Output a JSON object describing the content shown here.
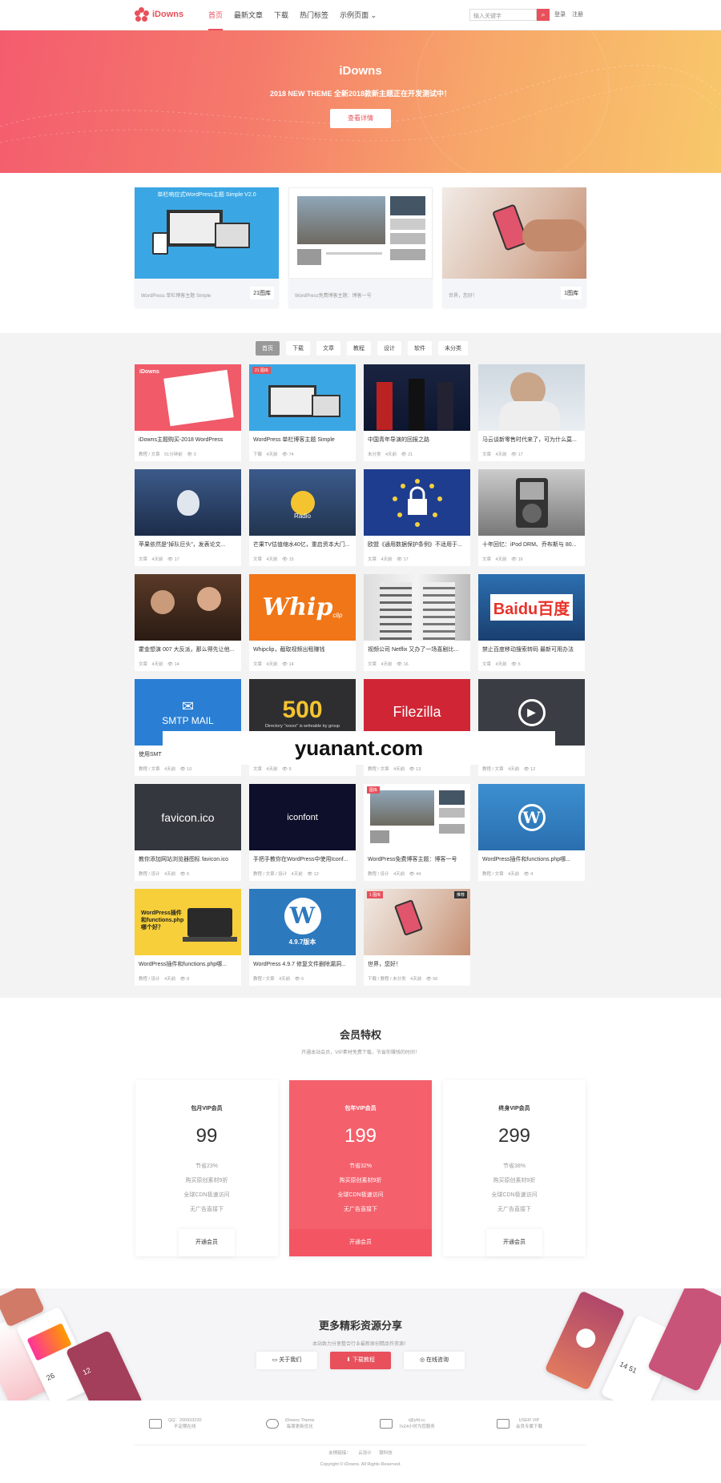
{
  "header": {
    "logo": "iDowns",
    "nav": [
      "首页",
      "最新文章",
      "下载",
      "热门标签",
      "示例页面"
    ],
    "search_placeholder": "输入关键字",
    "login": "登录",
    "register": "注册"
  },
  "hero": {
    "title": "iDowns",
    "subtitle": "2018 NEW THEME 全新2018款新主题正在开发测试中！",
    "button": "查看详情"
  },
  "featured": [
    {
      "caption": "WordPress 单栏博客主题 Simple",
      "count": "21图库"
    },
    {
      "caption": "WordPress免费博客主题：博客一号",
      "count": ""
    },
    {
      "caption": "世界，您好！",
      "count": "1图库"
    }
  ],
  "tabs": [
    "首页",
    "下载",
    "文章",
    "教程",
    "设计",
    "软件",
    "未分类"
  ],
  "cards": [
    {
      "title": "iDowns主题购买-2018 WordPress",
      "meta": "教程 / 文章　51分钟前　👁 3"
    },
    {
      "title": "WordPress 单栏博客主题 Simple",
      "meta": "下载　4天前　👁 74"
    },
    {
      "title": "中国青年导演的回报之路",
      "meta": "未分类　4天前　👁 21"
    },
    {
      "title": "马云谈新零售时代来了，可为什么莫...",
      "meta": "文章　4天前　👁 17"
    },
    {
      "title": "苹果依然是“掉队巨头”，发表论文...",
      "meta": "文章　4天前　👁 17"
    },
    {
      "title": "芒果TV估值缩水40亿，重启资本大门...",
      "meta": "文章　4天前　👁 15"
    },
    {
      "title": "欧盟《通用数据保护条例》不适用于...",
      "meta": "文章　4天前　👁 17"
    },
    {
      "title": "十年回忆：iPod DRM、乔布斯与 80...",
      "meta": "文章　4天前　👁 16"
    },
    {
      "title": "霍金想演 007 大反派，那么得先让他...",
      "meta": "文章　4天前　👁 14"
    },
    {
      "title": "Whipclip，截取视频出租赚钱",
      "meta": "文章　4天前　👁 14"
    },
    {
      "title": "视频公司 Netflix 又办了一场喜剧比...",
      "meta": "文章　4天前　👁 16"
    },
    {
      "title": "禁止百度移动搜索转码 最新可用办法",
      "meta": "文章　4天前　👁 5"
    },
    {
      "title": "使用SMT",
      "meta": "教程 / 文章　4天前　👁 10"
    },
    {
      "title": "",
      "meta": "文章　4天前　👁 5"
    },
    {
      "title": "",
      "meta": "教程 / 文章　4天前　👁 13"
    },
    {
      "title": "...链视频...",
      "meta": "教程 / 文章　4天前　👁 12"
    },
    {
      "title": "教你添加网站浏览器图标 favicon.ico",
      "meta": "教程 / 设计　4天前　👁 6"
    },
    {
      "title": "手把手教你在WordPress中使用Iconf...",
      "meta": "教程 / 文章 / 设计　4天前　👁 12"
    },
    {
      "title": "WordPress免费博客主题：博客一号",
      "meta": "教程 / 设计　4天前　👁 44"
    },
    {
      "title": "WordPress插件和functions.php哪...",
      "meta": "教程 / 文章　4天前　👁 4"
    },
    {
      "title": "WordPress插件和functions.php哪...",
      "meta": "教程 / 设计　4天前　👁 8"
    },
    {
      "title": "WordPress 4.9.7 修复文件删除漏洞...",
      "meta": "教程 / 文章　4天前　👁 6"
    },
    {
      "title": "世界，您好！",
      "meta": "下载 / 教程 / 未分类　4天前　👁 56"
    }
  ],
  "thumbs": {
    "simple_banner": "单栏响应式WordPress主题 Simple V2.0",
    "radio": "Radio",
    "whip": "Whip",
    "whip_small": "clip",
    "baidu": "Baidu百度",
    "smtp": "SMTP MAIL",
    "err500": "500",
    "err500_sub": "Directory \"xxxxx\" is writeable by group",
    "filezilla": "Filezilla",
    "favicon": "favicon.ico",
    "iconfont": "iconfont",
    "wp_plugin": "WordPress插件和functions.php哪个好？",
    "wp_version": "4.9.7版本",
    "tag_album21": "21 图库",
    "tag_album": "图库",
    "tag_album1": "1 图库",
    "tag_top": "推荐"
  },
  "watermark": "yuanant.com",
  "vip": {
    "title": "会员特权",
    "subtitle": "开通本站会员，VIP素材免费下载，节省你赚钱的时间！",
    "plans": [
      {
        "name": "包月VIP会员",
        "price": "99",
        "save": "节省23%",
        "f1": "购买原创素材9折",
        "f2": "全球CDN极速访问",
        "f3": "无广告直接下",
        "btn": "开通会员"
      },
      {
        "name": "包年VIP会员",
        "price": "199",
        "save": "节省32%",
        "f1": "购买原创素材9折",
        "f2": "全球CDN极速访问",
        "f3": "无广告直接下",
        "btn": "开通会员"
      },
      {
        "name": "终身VIP会员",
        "price": "299",
        "save": "节省38%",
        "f1": "购买原创素材9折",
        "f2": "全球CDN极速访问",
        "f3": "无广告直接下",
        "btn": "开通会员"
      }
    ]
  },
  "share": {
    "title": "更多精彩资源分享",
    "subtitle": "本站致力分享整合行业最新原创精品作资源！",
    "btn_about": "关于我们",
    "btn_download": "下载教程",
    "btn_consult": "在线咨询",
    "phone_numbers": [
      "26",
      "12",
      "14",
      "51"
    ]
  },
  "footer": {
    "items": [
      {
        "l1": "QQ：200933220",
        "l2": "不定期在线"
      },
      {
        "l1": "iDowns Theme",
        "l2": "每周更新优化"
      },
      {
        "l1": "i@yfd.cc",
        "l2": "7x24小时为您服务"
      },
      {
        "l1": "USER VIP",
        "l2": "会员专属下载"
      }
    ],
    "links_label": "友情链接：",
    "links": [
      "云设计",
      "银科技"
    ],
    "copyright": "Copyright © iDowns. All Rights Reserved."
  }
}
